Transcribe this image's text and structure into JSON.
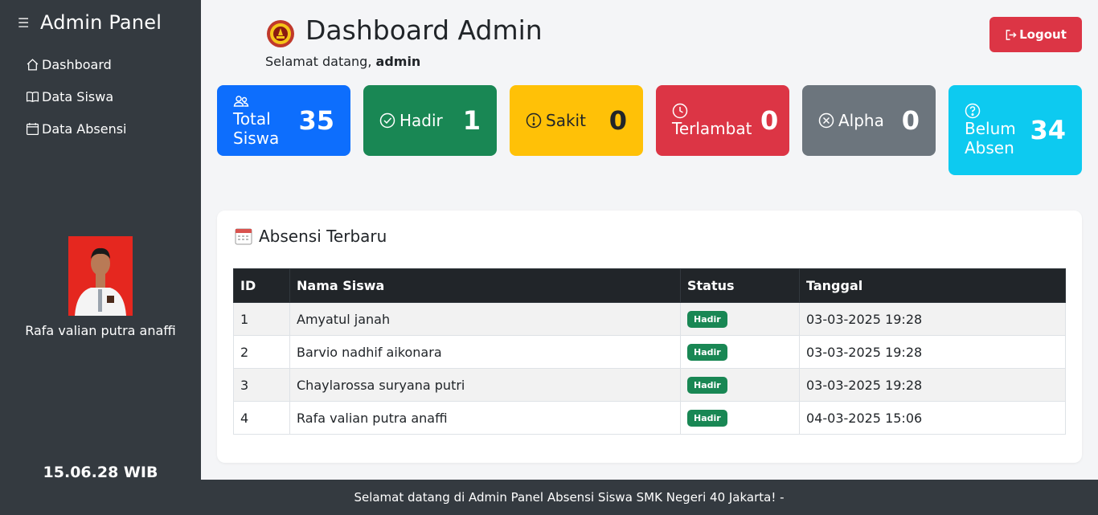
{
  "sidebar": {
    "menu_icon": "hamburger-icon",
    "title": "Admin Panel",
    "items": [
      {
        "label": "Dashboard",
        "icon": "house-icon"
      },
      {
        "label": "Data Siswa",
        "icon": "book-icon"
      },
      {
        "label": "Data Absensi",
        "icon": "calendar-icon"
      }
    ],
    "profile_name": "Rafa valian putra anaffi",
    "clock": "15.06.28 WIB"
  },
  "header": {
    "title": "Dashboard Admin",
    "welcome_prefix": "Selamat datang,",
    "welcome_user": "admin",
    "logout_label": "Logout"
  },
  "stats": [
    {
      "label": "Total Siswa",
      "value": "35",
      "color": "#0d6efd",
      "icon": "people-icon"
    },
    {
      "label": "Hadir",
      "value": "1",
      "color": "#198754",
      "icon": "check-circle-icon"
    },
    {
      "label": "Sakit",
      "value": "0",
      "color": "#ffc107",
      "icon": "exclamation-circle-icon"
    },
    {
      "label": "Terlambat",
      "value": "0",
      "color": "#dc3545",
      "icon": "clock-icon"
    },
    {
      "label": "Alpha",
      "value": "0",
      "color": "#6c757d",
      "icon": "x-circle-icon"
    },
    {
      "label": "Belum Absen",
      "value": "34",
      "color": "#0dcaf0",
      "icon": "question-circle-icon"
    }
  ],
  "recent": {
    "title": "Absensi Terbaru",
    "columns": [
      "ID",
      "Nama Siswa",
      "Status",
      "Tanggal"
    ],
    "rows": [
      {
        "id": "1",
        "name": "Amyatul janah",
        "status": "Hadir",
        "date": "03-03-2025 19:28"
      },
      {
        "id": "2",
        "name": "Barvio nadhif aikonara",
        "status": "Hadir",
        "date": "03-03-2025 19:28"
      },
      {
        "id": "3",
        "name": "Chaylarossa suryana putri",
        "status": "Hadir",
        "date": "03-03-2025 19:28"
      },
      {
        "id": "4",
        "name": "Rafa valian putra anaffi",
        "status": "Hadir",
        "date": "04-03-2025 15:06"
      }
    ]
  },
  "footer": {
    "marquee": "Selamat datang di Admin Panel Absensi Siswa SMK Negeri 40 Jakarta! -"
  }
}
